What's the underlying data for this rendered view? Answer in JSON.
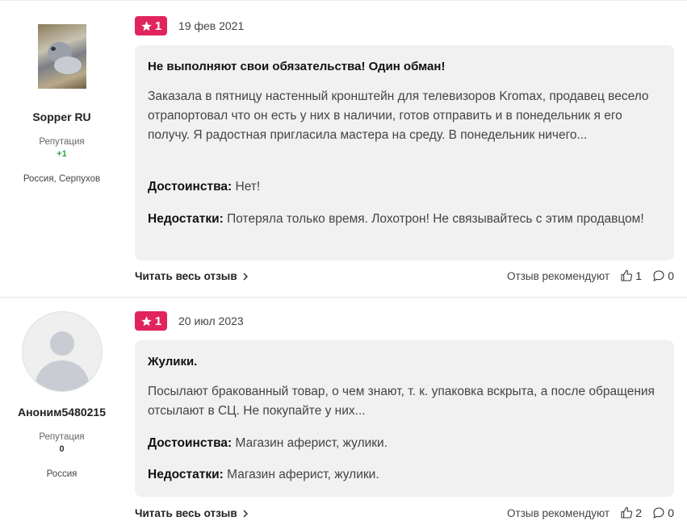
{
  "reviews": [
    {
      "author": {
        "name": "Sopper RU",
        "reputation_label": "Репутация",
        "reputation_value": "+1",
        "location": "Россия, Серпухов"
      },
      "rating": "1",
      "date": "19 фев 2021",
      "title": "Не выполняют свои обязательства! Один обман!",
      "text": "Заказала в пятницу настенный кронштейн для телевизоров Kromax, продавец весело отрапортовал что он есть у них в наличии, готов отправить и в понедельник я его получу. Я радостная пригласила мастера на среду. В понедельник ничего...",
      "pros_label": "Достоинства:",
      "pros": "Нет!",
      "cons_label": "Недостатки:",
      "cons": "Потеряла только время. Лохотрон! Не связывайтесь с этим продавцом!",
      "read_more": "Читать весь отзыв",
      "recommend_label": "Отзыв рекомендуют",
      "likes": "1",
      "comments": "0"
    },
    {
      "author": {
        "name": "Аноним5480215",
        "reputation_label": "Репутация",
        "reputation_value": "0",
        "location": "Россия"
      },
      "rating": "1",
      "date": "20 июл 2023",
      "title": "Жулики.",
      "text": "Посылают бракованный товар, о чем знают, т. к. упаковка вскрыта, а после обращения отсылают в СЦ. Не покупайте у них...",
      "pros_label": "Достоинства:",
      "pros": "Магазин аферист, жулики.",
      "cons_label": "Недостатки:",
      "cons": "Магазин аферист, жулики.",
      "read_more": "Читать весь отзыв",
      "recommend_label": "Отзыв рекомендуют",
      "likes": "2",
      "comments": "0"
    }
  ],
  "colors": {
    "badge": "#e0245e",
    "reputation_positive": "#2fa63c",
    "content_bg": "#f1f1f1"
  },
  "icons": {
    "rating": "star-icon",
    "read_more": "chevron-right-icon",
    "like": "thumbs-up-icon",
    "comment": "comment-icon"
  }
}
